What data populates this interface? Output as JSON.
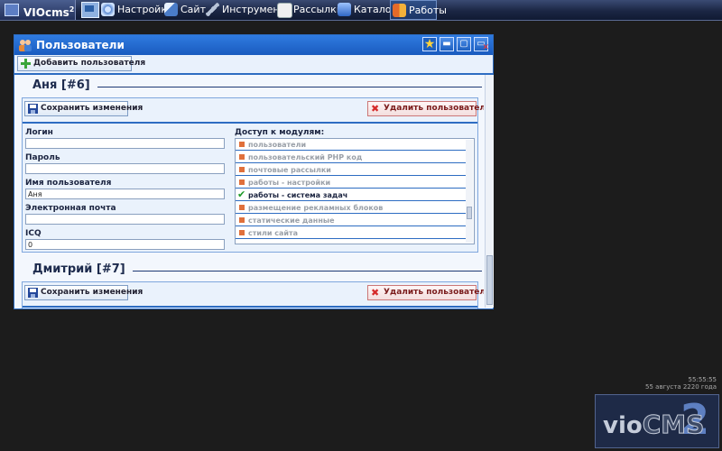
{
  "taskbar": {
    "brand": "VIOcms",
    "brand_sup": "2",
    "items": [
      {
        "label": "Настройки",
        "icon": "gears-icon"
      },
      {
        "label": "Сайт",
        "icon": "house-icon"
      },
      {
        "label": "Инструменты",
        "icon": "wrench-icon"
      },
      {
        "label": "Рассылки",
        "icon": "envelope-icon"
      },
      {
        "label": "Каталог",
        "icon": "catalog-icon"
      },
      {
        "label": "Работы",
        "icon": "flag-icon"
      }
    ]
  },
  "window": {
    "title": "Пользователи",
    "add_user_label": "Добавить пользователя"
  },
  "users": [
    {
      "heading": "Аня [#6]",
      "save_label": "Сохранить изменения",
      "delete_label": "Удалить пользователя",
      "fields": {
        "login_label": "Логин",
        "login_value": "",
        "password_label": "Пароль",
        "password_value": "",
        "username_label": "Имя пользователя",
        "username_value": "Аня",
        "email_label": "Электронная почта",
        "email_value": "",
        "icq_label": "ICQ",
        "icq_value": "0"
      },
      "modules_label": "Доступ к модулям:",
      "modules": [
        {
          "label": "пользователи",
          "checked": false
        },
        {
          "label": "пользовательский PHP код",
          "checked": false
        },
        {
          "label": "почтовые рассылки",
          "checked": false
        },
        {
          "label": "работы - настройки",
          "checked": false
        },
        {
          "label": "работы - система задач",
          "checked": true
        },
        {
          "label": "размещение рекламных блоков",
          "checked": false
        },
        {
          "label": "статические данные",
          "checked": false
        },
        {
          "label": "стили сайта",
          "checked": false
        }
      ]
    },
    {
      "heading": "Дмитрий [#7]",
      "save_label": "Сохранить изменения",
      "delete_label": "Удалить пользователя"
    }
  ],
  "clock": {
    "time": "55:55:55",
    "date": "55 августа 2220 года"
  },
  "logo": {
    "vio": "vio",
    "cms": "CMS",
    "num": "2"
  }
}
